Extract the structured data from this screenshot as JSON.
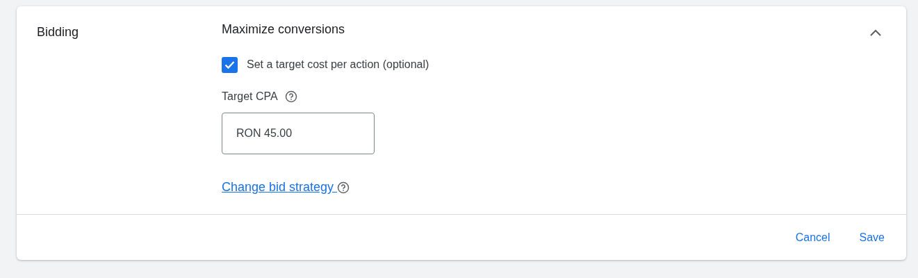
{
  "section": {
    "title": "Bidding",
    "expanded": true,
    "strategy": "Maximize conversions"
  },
  "target_option": {
    "label": "Set a target cost per action (optional)",
    "checked": true
  },
  "target_cpa": {
    "label": "Target CPA",
    "value": "RON 45.00"
  },
  "change_link": {
    "label": "Change bid strategy "
  },
  "buttons": [
    "Cancel",
    "Save"
  ]
}
